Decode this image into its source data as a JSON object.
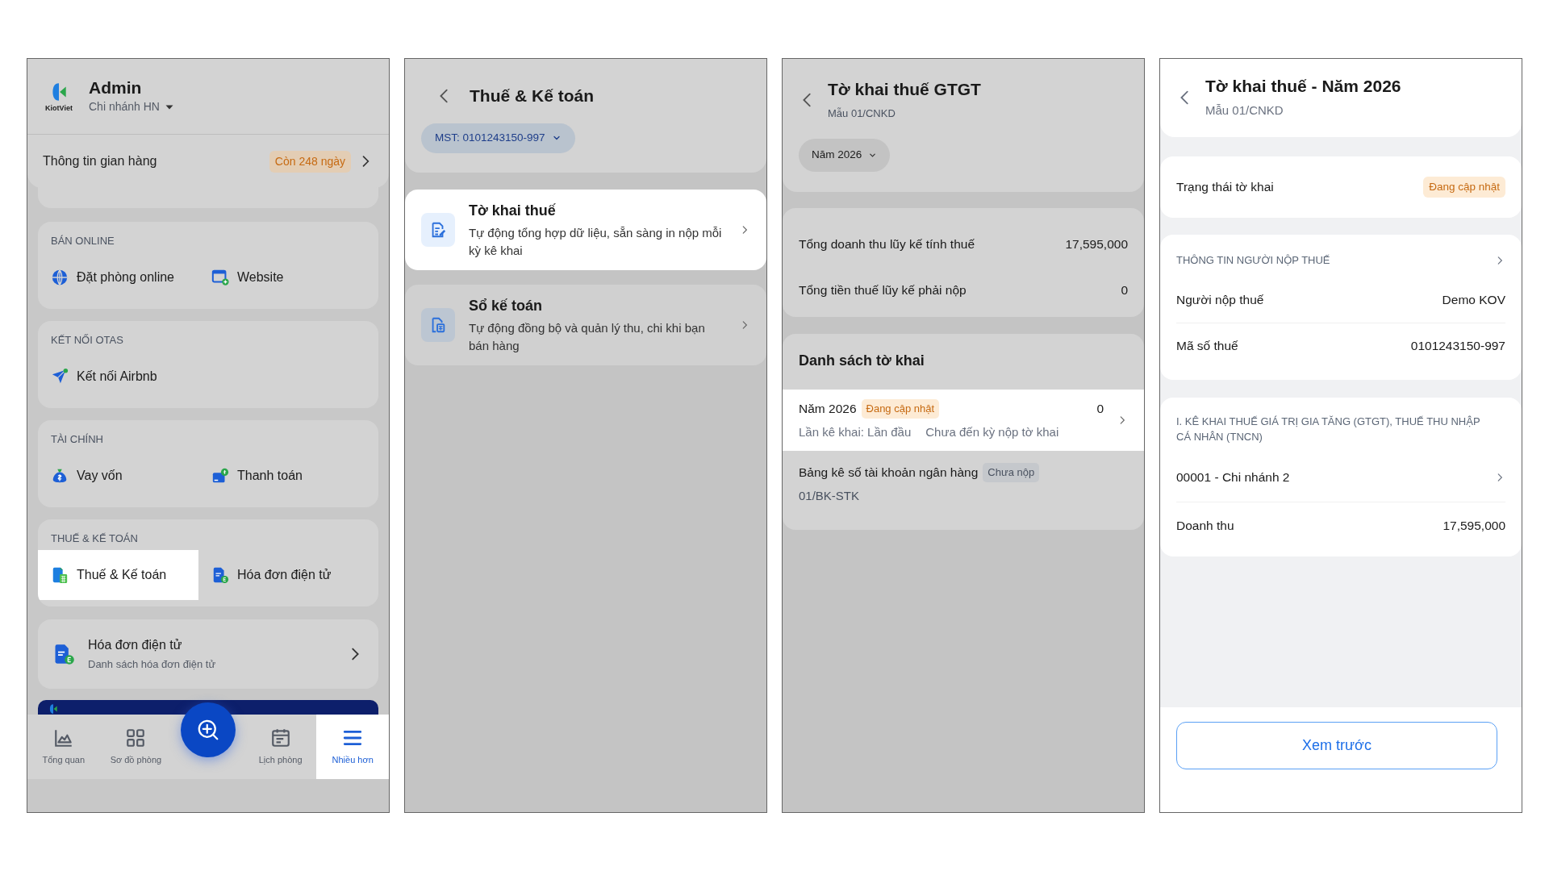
{
  "home_screen": {
    "logo_text": "KiotViet",
    "user_name": "Admin",
    "branch": "Chi nhánh HN",
    "store_info": {
      "label": "Thông tin gian hàng",
      "badge": "Còn 248 ngày"
    },
    "sections": [
      {
        "title": "BÁN ONLINE",
        "items": [
          {
            "label": "Đặt phòng online",
            "kind": "globe",
            "highlighted": false
          },
          {
            "label": "Website",
            "kind": "web",
            "highlighted": false
          }
        ]
      },
      {
        "title": "KẾT NỐI OTAS",
        "items": [
          {
            "label": "Kết nối Airbnb",
            "kind": "send",
            "highlighted": false
          }
        ]
      },
      {
        "title": "TÀI CHÍNH",
        "items": [
          {
            "label": "Vay vốn",
            "kind": "moneybag",
            "highlighted": false
          },
          {
            "label": "Thanh toán",
            "kind": "payment",
            "highlighted": false
          }
        ]
      },
      {
        "title": "THUẾ & KẾ TOÁN",
        "items": [
          {
            "label": "Thuế & Kế toán",
            "kind": "tax",
            "highlighted": true
          },
          {
            "label": "Hóa đơn điện tử",
            "kind": "einvoice",
            "highlighted": false
          }
        ]
      }
    ],
    "invoice_card": {
      "title": "Hóa đơn điện tử",
      "subtitle": "Danh sách hóa đơn điện tử"
    },
    "nav": [
      {
        "kind": "chart",
        "label": "Tổng quan",
        "selected": false
      },
      {
        "kind": "grid",
        "label": "Sơ đồ phòng",
        "selected": false
      },
      {
        "kind": "fab",
        "selected": false
      },
      {
        "kind": "calendar",
        "label": "Lịch phòng",
        "selected": false
      },
      {
        "kind": "menu",
        "label": "Nhiều hơn",
        "selected": true
      }
    ]
  },
  "tax_screen": {
    "title": "Thuế & Kế toán",
    "tax_code_chip": "MST: 0101243150-997",
    "items": [
      {
        "title": "Tờ khai thuế",
        "description": "Tự động tổng hợp dữ liệu, sẵn sàng in nộp mỗi kỳ kê khai",
        "kind": "declaration",
        "highlighted": true
      },
      {
        "title": "Sổ kế toán",
        "description": "Tự động đồng bộ và quản lý thu, chi khi bạn bán hàng",
        "kind": "ledger",
        "highlighted": false
      }
    ]
  },
  "declaration_screen": {
    "title": "Tờ khai thuế GTGT",
    "subtitle": "Mẫu 01/CNKD",
    "year_chip": "Năm 2026",
    "totals": [
      {
        "label": "Tổng doanh thu lũy kế tính thuế",
        "value": "17,595,000"
      },
      {
        "label": "Tổng tiền thuế lũy kế phải nộp",
        "value": "0"
      }
    ],
    "list_title": "Danh sách tờ khai",
    "declarations": [
      {
        "title": "Năm 2026",
        "badge": "Đang cập nhật",
        "color": "#c66a12",
        "value": "0",
        "details": [
          "Lần kê khai: Lần đầu",
          "Chưa đến kỳ nộp tờ khai"
        ],
        "highlighted": true
      },
      {
        "title": "Bảng kê số tài khoản ngân hàng",
        "badge": "Chưa nộp",
        "color": "#4a5260",
        "code": "01/BK-STK",
        "highlighted": false
      }
    ]
  },
  "detail_screen": {
    "title": "Tờ khai thuế - Năm 2026",
    "subtitle": "Mẫu 01/CNKD",
    "status": {
      "label": "Trạng thái tờ khai",
      "badge": "Đang cập nhật"
    },
    "taxpayer_section": {
      "title": "THÔNG TIN NGƯỜI NỘP THUẾ",
      "rows": [
        {
          "label": "Người nộp thuế",
          "value": "Demo KOV"
        },
        {
          "label": "Mã số thuế",
          "value": "0101243150-997"
        }
      ]
    },
    "declaration_section": {
      "title": "I. KÊ KHAI THUẾ GIÁ TRỊ GIA TĂNG (GTGT), THUẾ THU NHẬP CÁ NHÂN (TNCN)",
      "branch": "00001 - Chi nhánh 2",
      "rows": [
        {
          "label": "Doanh thu",
          "value": "17,595,000"
        }
      ]
    },
    "preview_button": "Xem trước"
  }
}
